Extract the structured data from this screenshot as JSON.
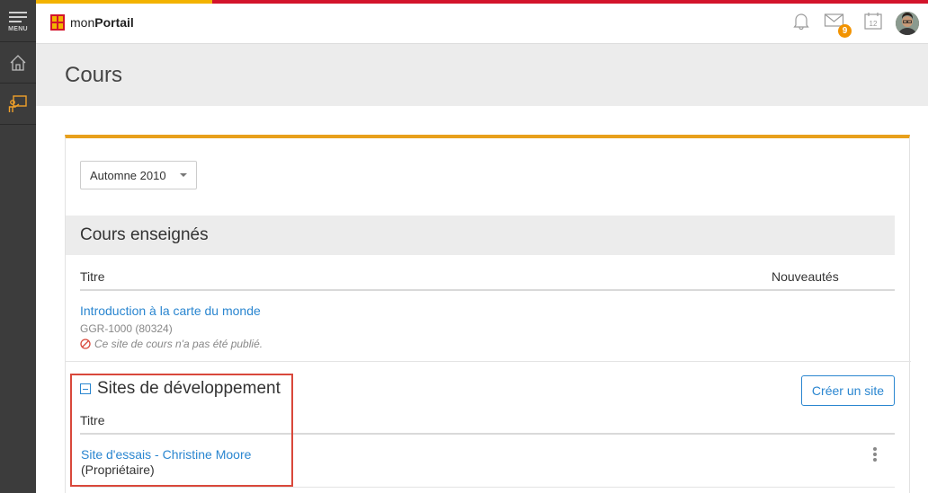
{
  "app": {
    "brand_prefix": "mon",
    "brand_bold": "Portail",
    "menu_label": "MENU",
    "messages_badge": "9",
    "calendar_day": "12"
  },
  "page": {
    "title": "Cours"
  },
  "session": {
    "selected": "Automne 2010"
  },
  "taught": {
    "section_title": "Cours enseignés",
    "col_title": "Titre",
    "col_news": "Nouveautés",
    "courses": [
      {
        "title": "Introduction à la carte du monde",
        "code": "GGR-1000 (80324)",
        "status": "Ce site de cours n'a pas été publié."
      }
    ]
  },
  "dev": {
    "section_title": "Sites de développement",
    "create_label": "Créer un site",
    "col_title": "Titre",
    "sites": [
      {
        "title": "Site d'essais - Christine Moore",
        "role": "(Propriétaire)"
      }
    ]
  },
  "colors": {
    "accent_orange": "#e8a01c",
    "brand_red": "#d3142b",
    "link_blue": "#2a86d0",
    "highlight_red": "#d9483b"
  }
}
